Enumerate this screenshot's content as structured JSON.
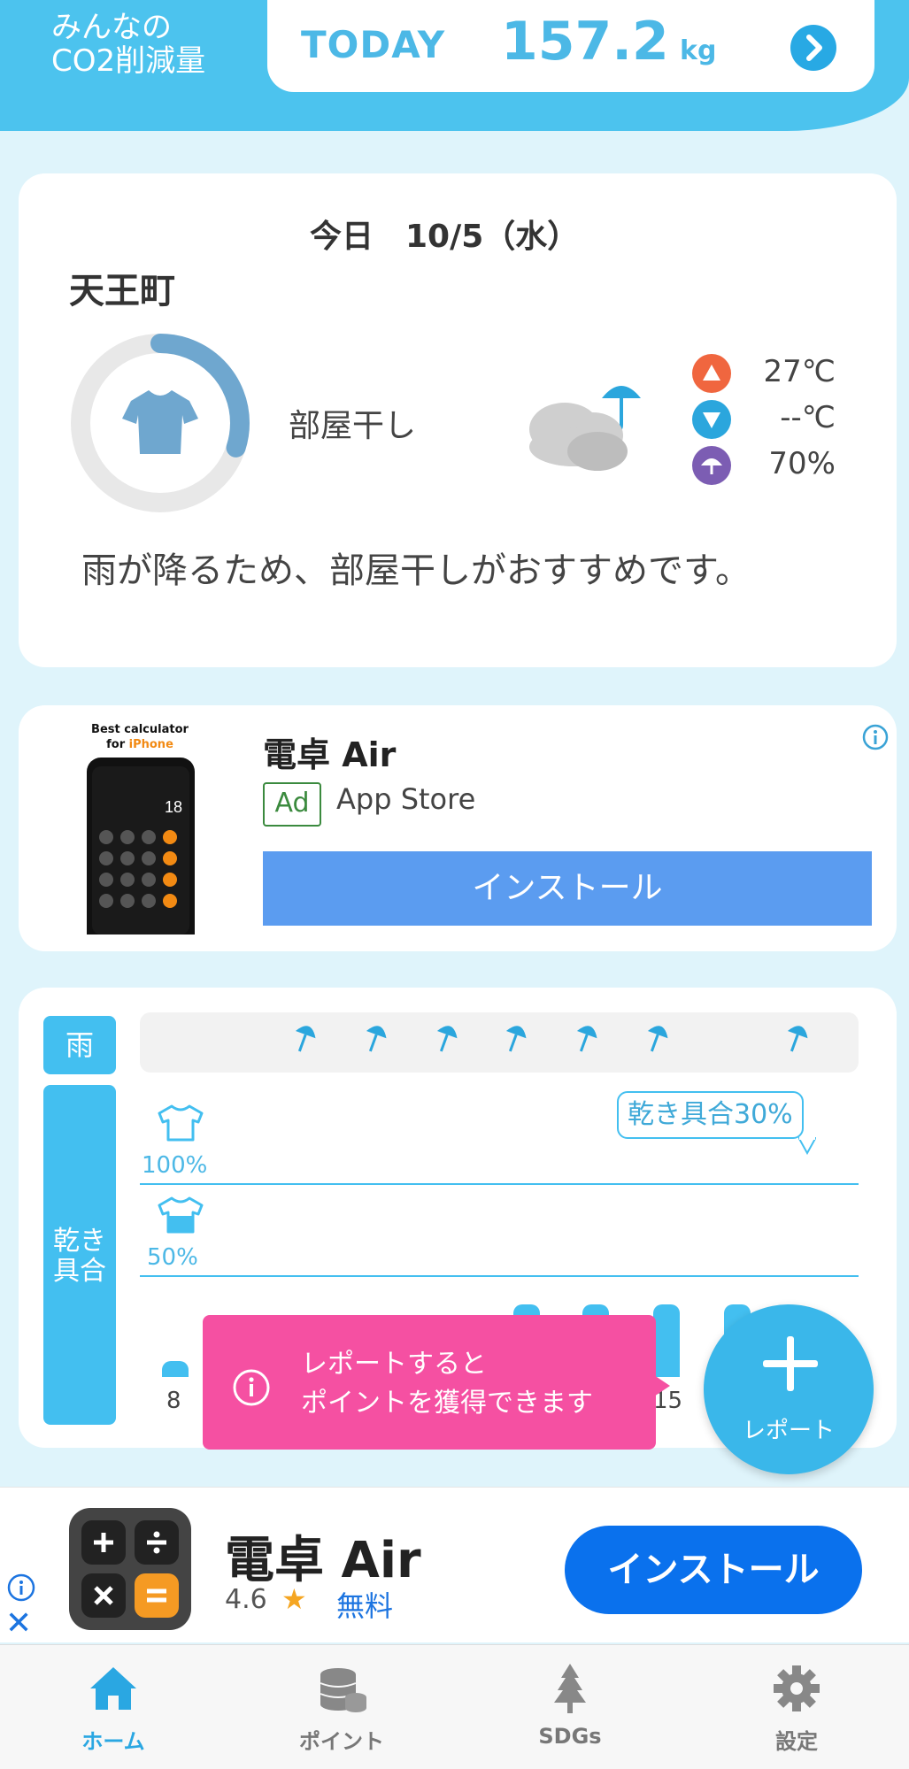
{
  "header": {
    "co2_label_line1": "みんなの",
    "co2_label_line2": "CO2削減量",
    "today_label": "TODAY",
    "today_value": "157.2",
    "today_unit": "kg"
  },
  "weather": {
    "date": "今日　10/5（水）",
    "town": "天王町",
    "verdict": "部屋干し",
    "dryness_level": 0.3,
    "high_temp": "27℃",
    "low_temp": "--℃",
    "rain_prob": "70%",
    "advice": "雨が降るため、部屋干しがおすすめです。"
  },
  "ad_card": {
    "phone_caption_line1": "Best calculator",
    "phone_caption_for": "for ",
    "phone_caption_brand": "iPhone",
    "phone_display": "18",
    "title": "電卓 Air",
    "badge": "Ad",
    "store": "App Store",
    "install": "インストール"
  },
  "dryness_chart": {
    "rain_label": "雨",
    "dry_label_line1": "乾き",
    "dry_label_line2": "具合",
    "level_100": "100%",
    "level_50": "50%",
    "bubble": "乾き具合30%",
    "hour_start": "8",
    "hour_end": "15"
  },
  "toast": {
    "line1": "レポートすると",
    "line2": "ポイントを獲得できます"
  },
  "fab": {
    "label": "レポート"
  },
  "banner_ad": {
    "title": "電卓 Air",
    "rating": "4.6",
    "star": "★",
    "price": "無料",
    "install": "インストール",
    "close": "✕"
  },
  "nav": {
    "home": "ホーム",
    "points": "ポイント",
    "sdgs": "SDGs",
    "settings": "設定"
  },
  "colors": {
    "primary": "#43bff0",
    "toast": "#f550a2",
    "install_blue": "#0a71ed"
  }
}
